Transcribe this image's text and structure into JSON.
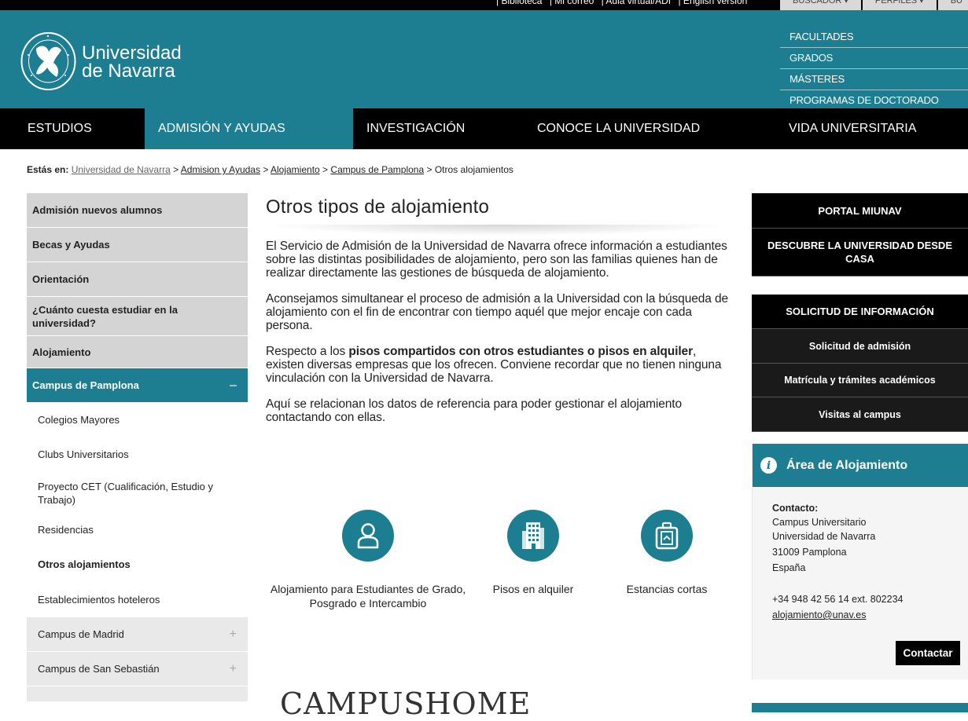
{
  "topbar": {
    "links": [
      "| Biblioteca",
      "| Mi correo",
      "| Aula virtual/ADI",
      "| English version"
    ],
    "buttons": [
      "BUSCADOR ▾",
      "PERFILES ▾",
      "BU"
    ]
  },
  "brand": {
    "line1": "Universidad",
    "line2": "de Navarra"
  },
  "quick_links": [
    "FACULTADES",
    "GRADOS",
    "MÁSTERES",
    "PROGRAMAS DE DOCTORADO"
  ],
  "mainnav": [
    "ESTUDIOS",
    "ADMISIÓN Y AYUDAS",
    "INVESTIGACIÓN",
    "CONOCE LA UNIVERSIDAD",
    "VIDA UNIVERSITARIA"
  ],
  "breadcrumb": {
    "prefix": "Estás en:",
    "items": [
      "Universidad de Navarra",
      "Admision y Ayudas",
      "Alojamiento",
      "Campus de Pamplona"
    ],
    "current": "Otros alojamientos",
    "sep": ">"
  },
  "sidebar": {
    "l1": [
      "Admisión nuevos alumnos",
      "Becas y Ayudas",
      "Orientación",
      "¿Cuánto cuesta estudiar en la universidad?",
      "Alojamiento"
    ],
    "current": "Campus de Pamplona",
    "current_toggle": "–",
    "l2": [
      "Colegios Mayores",
      "Clubs Universitarios",
      "Proyecto CET (Cualificación, Estudio y Trabajo)",
      "Residencias",
      "Otros alojamientos",
      "Establecimientos hoteleros"
    ],
    "campus": [
      "Campus de Madrid",
      "Campus de San Sebastián"
    ],
    "campus_toggle": "+"
  },
  "content": {
    "title": "Otros tipos de alojamiento",
    "p1": "El Servicio de Admisión de la Universidad de Navarra ofrece información a estudiantes sobre las distintas posibilidades de alojamiento, pero son las familias quienes han de realizar directamente las gestiones de búsqueda de alojamiento.",
    "p2": "Aconsejamos simultanear el proceso de admisión a la Universidad con la búsqueda de alojamiento con el fin de encontrar con tiempo aquél que mejor encaje con cada persona.",
    "p3_a": "Respecto a los ",
    "p3_b": "pisos compartidos con otros estudiantes o pisos en alquiler",
    "p3_c": ", existen diversas empresas que los ofrecen. Conviene recordar que no tienen ninguna vinculación con la Universidad de Navarra.",
    "p4": "Aquí se relacionan los datos de referencia para poder gestionar el alojamiento contactando con ellas.",
    "cards": [
      {
        "icon": "person-icon",
        "label": "Alojamiento para Estudiantes de Grado, Posgrado e Intercambio"
      },
      {
        "icon": "building-icon",
        "label": "Pisos en alquiler"
      },
      {
        "icon": "suitcase-icon",
        "label": "Estancias cortas"
      }
    ],
    "partner_logo": "CAMPUSHOME"
  },
  "right": {
    "portal": "PORTAL MIUNAV",
    "descubre": "DESCUBRE LA UNIVERSIDAD DESDE CASA",
    "solicitud": "SOLICITUD DE INFORMACIÓN",
    "sublinks": [
      "Solicitud de admisión",
      "Matrícula y trámites académicos",
      "Visitas al campus"
    ],
    "box": {
      "title": "Área de Alojamiento",
      "contact_label": "Contacto:",
      "lines": [
        "Campus Universitario",
        "Universidad de Navarra",
        "31009 Pamplona",
        "España"
      ],
      "phone": "+34 948 42 56 14 ext. 802234",
      "email": "alojamiento@unav.es",
      "button": "Contactar"
    }
  },
  "colors": {
    "teal": "#1e7e91",
    "black": "#000000",
    "grey": "#d4d4d4"
  }
}
